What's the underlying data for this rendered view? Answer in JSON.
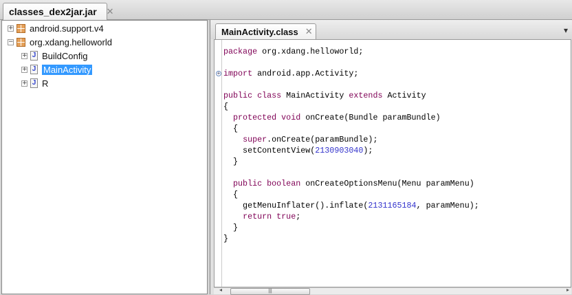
{
  "window_tab": {
    "label": "classes_dex2jar.jar",
    "close": "✕"
  },
  "tree": [
    {
      "label": "android.support.v4",
      "type": "package",
      "expanded": false
    },
    {
      "label": "org.xdang.helloworld",
      "type": "package",
      "expanded": true
    },
    {
      "label": "BuildConfig",
      "type": "class"
    },
    {
      "label": "MainActivity",
      "type": "class",
      "selected": true
    },
    {
      "label": "R",
      "type": "class"
    }
  ],
  "editor_tab": {
    "label": "MainActivity.class",
    "close": "✕",
    "menu": "▾"
  },
  "colors": {
    "keyword": "#7f0055",
    "number": "#3333cc",
    "selection": "#3399ff"
  },
  "code": [
    [
      [
        "kw",
        "package"
      ],
      [
        "t",
        " org.xdang.helloworld;"
      ]
    ],
    [],
    [
      [
        "kw",
        "import"
      ],
      [
        "t",
        " android.app.Activity;"
      ]
    ],
    [],
    [
      [
        "kw",
        "public class"
      ],
      [
        "t",
        " MainActivity "
      ],
      [
        "kw",
        "extends"
      ],
      [
        "t",
        " Activity"
      ]
    ],
    [
      [
        "t",
        "{"
      ]
    ],
    [
      [
        "t",
        "  "
      ],
      [
        "kw",
        "protected void"
      ],
      [
        "t",
        " onCreate(Bundle paramBundle)"
      ]
    ],
    [
      [
        "t",
        "  {"
      ]
    ],
    [
      [
        "t",
        "    "
      ],
      [
        "kw",
        "super"
      ],
      [
        "t",
        ".onCreate(paramBundle);"
      ]
    ],
    [
      [
        "t",
        "    setContentView("
      ],
      [
        "num",
        "2130903040"
      ],
      [
        "t",
        ");"
      ]
    ],
    [
      [
        "t",
        "  }"
      ]
    ],
    [],
    [
      [
        "t",
        "  "
      ],
      [
        "kw",
        "public boolean"
      ],
      [
        "t",
        " onCreateOptionsMenu(Menu paramMenu)"
      ]
    ],
    [
      [
        "t",
        "  {"
      ]
    ],
    [
      [
        "t",
        "    getMenuInflater().inflate("
      ],
      [
        "num",
        "2131165184"
      ],
      [
        "t",
        ", paramMenu);"
      ]
    ],
    [
      [
        "t",
        "    "
      ],
      [
        "kw",
        "return true"
      ],
      [
        "t",
        ";"
      ]
    ],
    [
      [
        "t",
        "  }"
      ]
    ],
    [
      [
        "t",
        "}"
      ]
    ]
  ]
}
